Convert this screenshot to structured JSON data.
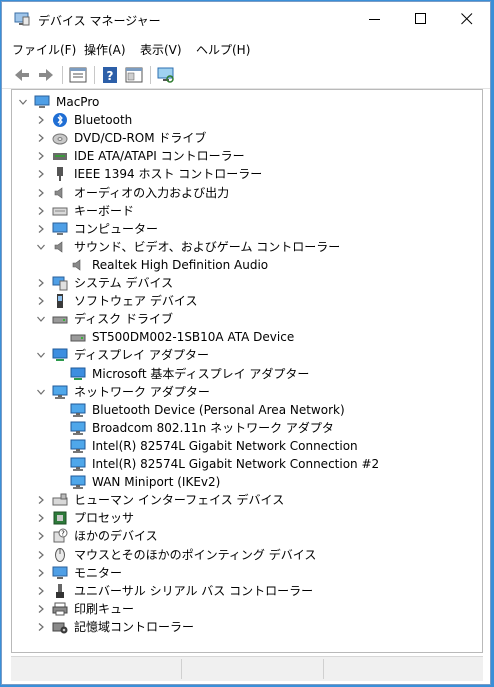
{
  "window": {
    "title": "デバイス マネージャー",
    "controls": {
      "minimize": "minimize-icon",
      "maximize": "maximize-icon",
      "close": "close-icon"
    }
  },
  "menu": [
    "ファイル(F)",
    "操作(A)",
    "表示(V)",
    "ヘルプ(H)"
  ],
  "toolbar": [
    "back-icon",
    "forward-icon",
    "properties-icon",
    "help-icon",
    "show-hide-icon",
    "monitor-scan-icon"
  ],
  "tree": {
    "root": {
      "label": "MacPro",
      "icon": "computer-icon",
      "expanded": true
    },
    "items": [
      {
        "label": "Bluetooth",
        "icon": "bluetooth-icon",
        "expanded": false
      },
      {
        "label": "DVD/CD-ROM ドライブ",
        "icon": "dvd-icon",
        "expanded": false
      },
      {
        "label": "IDE ATA/ATAPI コントローラー",
        "icon": "ide-icon",
        "expanded": false
      },
      {
        "label": "IEEE 1394 ホスト コントローラー",
        "icon": "ieee1394-icon",
        "expanded": false
      },
      {
        "label": "オーディオの入力および出力",
        "icon": "speaker-icon",
        "expanded": false
      },
      {
        "label": "キーボード",
        "icon": "keyboard-icon",
        "expanded": false
      },
      {
        "label": "コンピューター",
        "icon": "computer-icon",
        "expanded": false
      },
      {
        "label": "サウンド、ビデオ、およびゲーム コントローラー",
        "icon": "speaker-icon",
        "expanded": true,
        "children": [
          {
            "label": "Realtek High Definition Audio",
            "icon": "speaker-icon"
          }
        ]
      },
      {
        "label": "システム デバイス",
        "icon": "system-icon",
        "expanded": false
      },
      {
        "label": "ソフトウェア デバイス",
        "icon": "software-icon",
        "expanded": false
      },
      {
        "label": "ディスク ドライブ",
        "icon": "disk-icon",
        "expanded": true,
        "children": [
          {
            "label": "ST500DM002-1SB10A ATA Device",
            "icon": "disk-icon"
          }
        ]
      },
      {
        "label": "ディスプレイ アダプター",
        "icon": "display-icon",
        "expanded": true,
        "children": [
          {
            "label": "Microsoft 基本ディスプレイ アダプター",
            "icon": "display-icon"
          }
        ]
      },
      {
        "label": "ネットワーク アダプター",
        "icon": "network-icon",
        "expanded": true,
        "children": [
          {
            "label": "Bluetooth Device (Personal Area Network)",
            "icon": "network-icon"
          },
          {
            "label": "Broadcom 802.11n ネットワーク アダプタ",
            "icon": "network-icon"
          },
          {
            "label": "Intel(R) 82574L Gigabit Network Connection",
            "icon": "network-icon"
          },
          {
            "label": "Intel(R) 82574L Gigabit Network Connection #2",
            "icon": "network-icon"
          },
          {
            "label": "WAN Miniport (IKEv2)",
            "icon": "network-icon"
          }
        ]
      },
      {
        "label": "ヒューマン インターフェイス デバイス",
        "icon": "hid-icon",
        "expanded": false
      },
      {
        "label": "プロセッサ",
        "icon": "processor-icon",
        "expanded": false
      },
      {
        "label": "ほかのデバイス",
        "icon": "unknown-device-icon",
        "expanded": false
      },
      {
        "label": "マウスとそのほかのポインティング デバイス",
        "icon": "mouse-icon",
        "expanded": false
      },
      {
        "label": "モニター",
        "icon": "monitor-icon",
        "expanded": false
      },
      {
        "label": "ユニバーサル シリアル バス コントローラー",
        "icon": "usb-icon",
        "expanded": false
      },
      {
        "label": "印刷キュー",
        "icon": "printer-icon",
        "expanded": false
      },
      {
        "label": "記憶域コントローラー",
        "icon": "storage-controller-icon",
        "expanded": false
      }
    ]
  },
  "colors": {
    "selection": "#cce8ff",
    "chevron": "#6e6e6e",
    "icon_blue": "#2d7fd2"
  }
}
